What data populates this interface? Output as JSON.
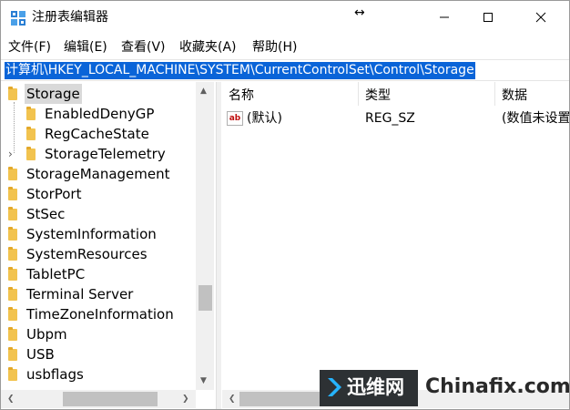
{
  "window": {
    "title": "注册表编辑器",
    "resize_glyph": "↔",
    "minimize_icon": "minimize-icon",
    "maximize_icon": "maximize-icon",
    "close_icon": "close-icon"
  },
  "menu": [
    {
      "label": "文件(F)"
    },
    {
      "label": "编辑(E)"
    },
    {
      "label": "查看(V)"
    },
    {
      "label": "收藏夹(A)"
    },
    {
      "label": "帮助(H)"
    }
  ],
  "address": {
    "path": "计算机\\HKEY_LOCAL_MACHINE\\SYSTEM\\CurrentControlSet\\Control\\Storage"
  },
  "tree": {
    "items": [
      {
        "label": "Storage",
        "selected": true
      },
      {
        "label": "EnabledDenyGP"
      },
      {
        "label": "RegCacheState"
      },
      {
        "label": "StorageTelemetry",
        "expandable": true
      },
      {
        "label": "StorageManagement"
      },
      {
        "label": "StorPort"
      },
      {
        "label": "StSec"
      },
      {
        "label": "SystemInformation"
      },
      {
        "label": "SystemResources"
      },
      {
        "label": "TabletPC"
      },
      {
        "label": "Terminal Server"
      },
      {
        "label": "TimeZoneInformation"
      },
      {
        "label": "Ubpm"
      },
      {
        "label": "USB"
      },
      {
        "label": "usbflags"
      }
    ],
    "expander_glyph": "›"
  },
  "values": {
    "columns": [
      "名称",
      "类型",
      "数据"
    ],
    "rows": [
      {
        "icon": "ab",
        "name": "(默认)",
        "type": "REG_SZ",
        "data": "(数值未设置"
      }
    ]
  },
  "scroll": {
    "up": "▲",
    "down": "▼",
    "left": "❮",
    "right": "❯"
  },
  "watermark": {
    "cn": "迅维网",
    "en": "Chinafix.com",
    "accent": "#26b3ff"
  },
  "colors": {
    "selection": "#0a64d8",
    "folder": "#f2c34f"
  }
}
